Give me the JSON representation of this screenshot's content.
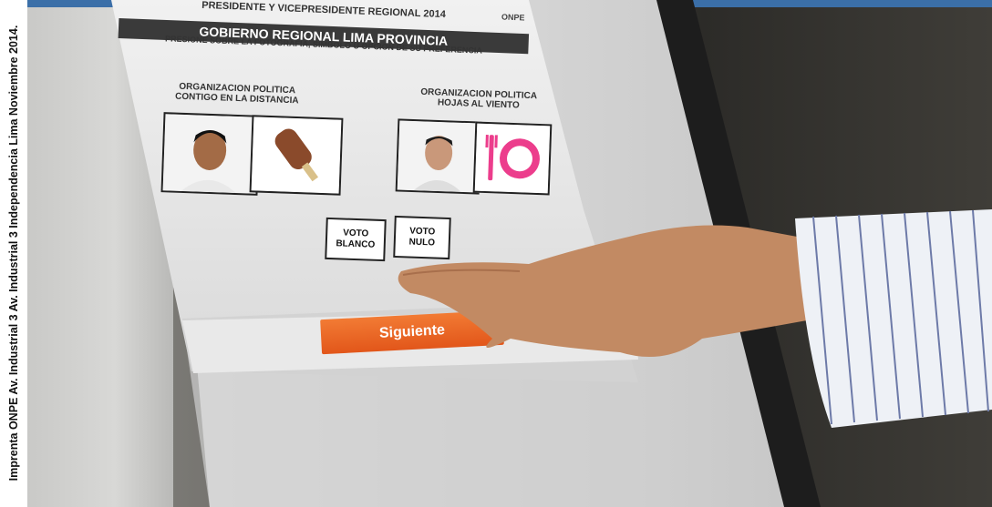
{
  "imprint": "Imprenta ONPE  Av. Industrial 3 Av. Industrial 3 Independencia  Lima  Noviembre 2014.",
  "ballot": {
    "header": "PRESIDENTE Y VICEPRESIDENTE REGIONAL 2014",
    "logo": "ONPE",
    "region": "GOBIERNO REGIONAL LIMA PROVINCIA",
    "instruction": "PRESIONE SOBRE LA FOTOGRAFIA, SIMBOLO U OPCION DE SU PREFERENCIA",
    "org1": {
      "line1": "ORGANIZACION POLITICA",
      "line2": "CONTIGO EN LA DISTANCIA",
      "symbol": "popsicle-icon"
    },
    "org2": {
      "line1": "ORGANIZACION POLITICA",
      "line2": "HOJAS AL VIENTO",
      "symbol": "plate-cutlery-icon"
    },
    "blank_vote": {
      "line1": "VOTO",
      "line2": "BLANCO"
    },
    "null_vote": {
      "line1": "VOTO",
      "line2": "NULO"
    },
    "next": "Siguiente",
    "next_arrow": "›"
  },
  "colors": {
    "accent": "#e8611f",
    "header_bar": "#3a3a3a",
    "top_band": "#3b6fa8",
    "symbol_pink": "#ec3d8c"
  }
}
